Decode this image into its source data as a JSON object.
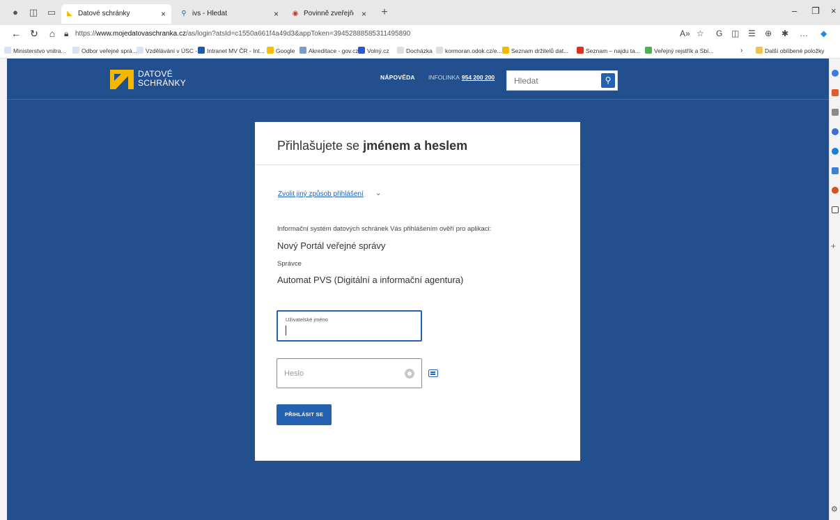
{
  "browser": {
    "tabs": [
      {
        "label": "Datové schránky",
        "active": true
      },
      {
        "label": "ivs - Hledat",
        "active": false
      },
      {
        "label": "Povinně zveřejňované informace",
        "active": false
      }
    ],
    "address": {
      "prefix": "https://",
      "domain": "www.mojedatovaschranka.cz",
      "path": "/as/login?atsId=c1550a661f4a49d3&appToken=39452888585311495890"
    },
    "favorites": [
      "Ministerstvo vnitra...",
      "Odbor veřejné sprá...",
      "Vzdělávání v ÚSC -...",
      "Intranet MV ČR - Int...",
      "Google",
      "Akreditace - gov.cz",
      "Volný.cz",
      "Docházka",
      "kormoran.odok.cz/e...",
      "Seznam držitelů dat...",
      "Seznam – najdu ta...",
      "Veřejný rejstřík a Sbí..."
    ],
    "favorites_more": "Další oblíbené položky"
  },
  "header": {
    "logo_line1": "DATOVÉ",
    "logo_line2": "SCHRÁNKY",
    "help": "NÁPOVĚDA",
    "infoline_label": "INFOLINKA",
    "infoline_number": "954 200 200",
    "search_placeholder": "Hledat"
  },
  "login": {
    "title_prefix": "Přihlašujete se",
    "title_bold": "jménem a heslem",
    "alt_method": "Zvolit jiný způsob přihlášení",
    "info": "Informační systém datových schránek Vás přihlášením ověří pro aplikaci:",
    "app_name": "Nový Portál veřejné správy",
    "admin_label": "Správce",
    "admin_name": "Automat PVS (Digitální a informační agentura)",
    "username_label": "Uživatelské jméno",
    "username_value": "",
    "password_placeholder": "Heslo",
    "submit": "PŘIHLÁSIT SE"
  },
  "colors": {
    "page_bg": "#244f8f",
    "accent": "#2362b2",
    "logo_yellow": "#f5b800"
  }
}
